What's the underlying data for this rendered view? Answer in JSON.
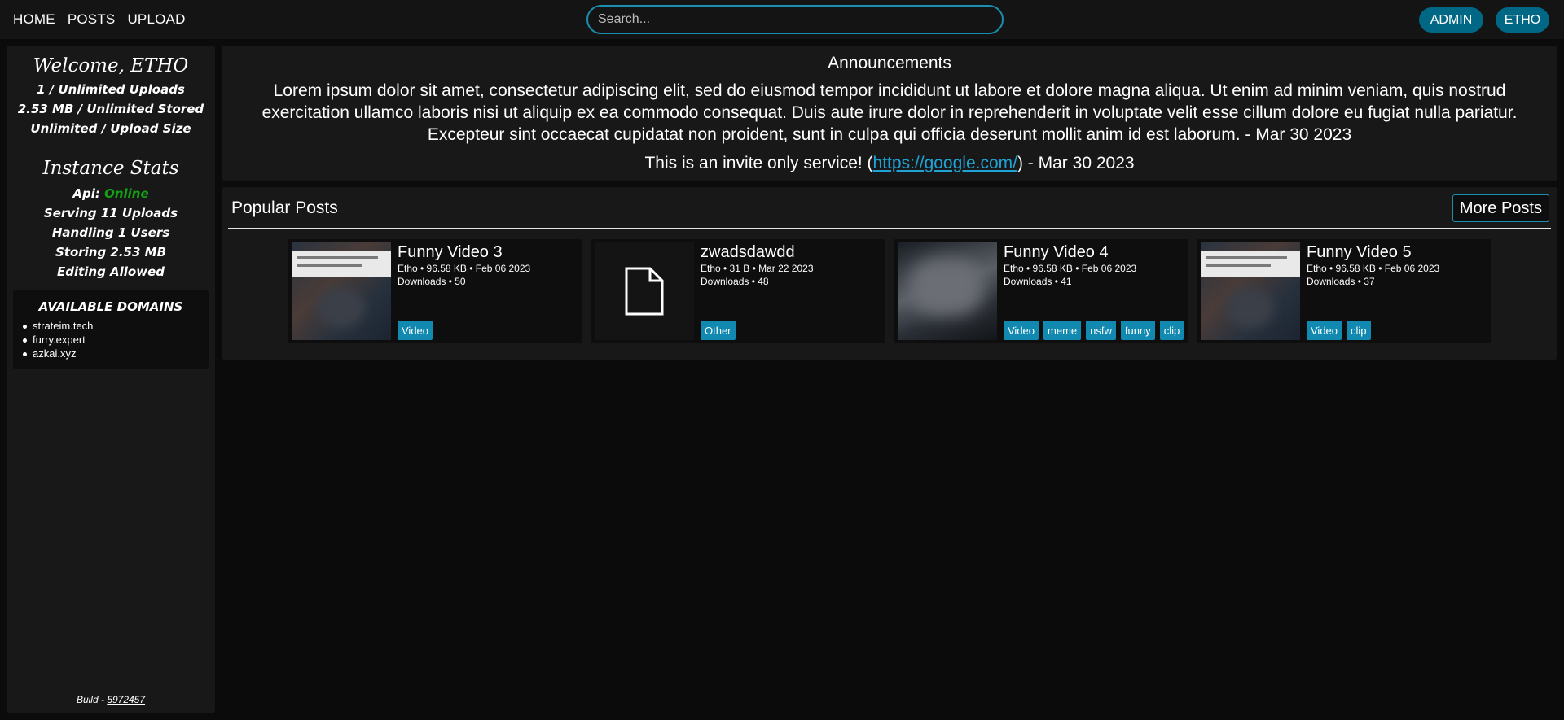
{
  "nav": {
    "links": [
      "HOME",
      "POSTS",
      "UPLOAD"
    ],
    "search_placeholder": "Search...",
    "admin_label": "ADMIN",
    "user_label": "ETHO"
  },
  "sidebar": {
    "welcome": "Welcome, ETHO",
    "uploads": "1 / Unlimited Uploads",
    "stored": "2.53 MB / Unlimited Stored",
    "upload_size": "Unlimited / Upload Size",
    "instance_title": "Instance Stats",
    "api_label": "Api:",
    "api_status": "Online",
    "serving": "Serving 11 Uploads",
    "handling": "Handling 1 Users",
    "storing": "Storing 2.53 MB",
    "editing": "Editing Allowed",
    "domains_title": "AVAILABLE DOMAINS",
    "domains": [
      "strateim.tech",
      "furry.expert",
      "azkai.xyz"
    ],
    "build_label": "Build -",
    "build_hash": "5972457"
  },
  "announcements": {
    "title": "Announcements",
    "text": "Lorem ipsum dolor sit amet, consectetur adipiscing elit, sed do eiusmod tempor incididunt ut labore et dolore magna aliqua. Ut enim ad minim veniam, quis nostrud exercitation ullamco laboris nisi ut aliquip ex ea commodo consequat. Duis aute irure dolor in reprehenderit in voluptate velit esse cillum dolore eu fugiat nulla pariatur. Excepteur sint occaecat cupidatat non proident, sunt in culpa qui officia deserunt mollit anim id est laborum. - Mar 30 2023",
    "invite_prefix": "This is an invite only service! (",
    "invite_link": "https://google.com/",
    "invite_suffix": ") - Mar 30 2023"
  },
  "popular": {
    "title": "Popular Posts",
    "more_label": "More Posts",
    "posts": [
      {
        "title": "Funny Video 3",
        "meta": "Etho • 96.58 KB • Feb 06 2023",
        "downloads": "Downloads • 50",
        "tags": [
          "Video"
        ],
        "thumb": "video"
      },
      {
        "title": "zwadsdawdd",
        "meta": "Etho • 31 B • Mar 22 2023",
        "downloads": "Downloads • 48",
        "tags": [
          "Other"
        ],
        "thumb": "file"
      },
      {
        "title": "Funny Video 4",
        "meta": "Etho • 96.58 KB • Feb 06 2023",
        "downloads": "Downloads • 41",
        "tags": [
          "Video",
          "meme",
          "nsfw",
          "funny",
          "clip"
        ],
        "thumb": "blur"
      },
      {
        "title": "Funny Video 5",
        "meta": "Etho • 96.58 KB • Feb 06 2023",
        "downloads": "Downloads • 37",
        "tags": [
          "Video",
          "clip"
        ],
        "thumb": "video"
      }
    ]
  }
}
